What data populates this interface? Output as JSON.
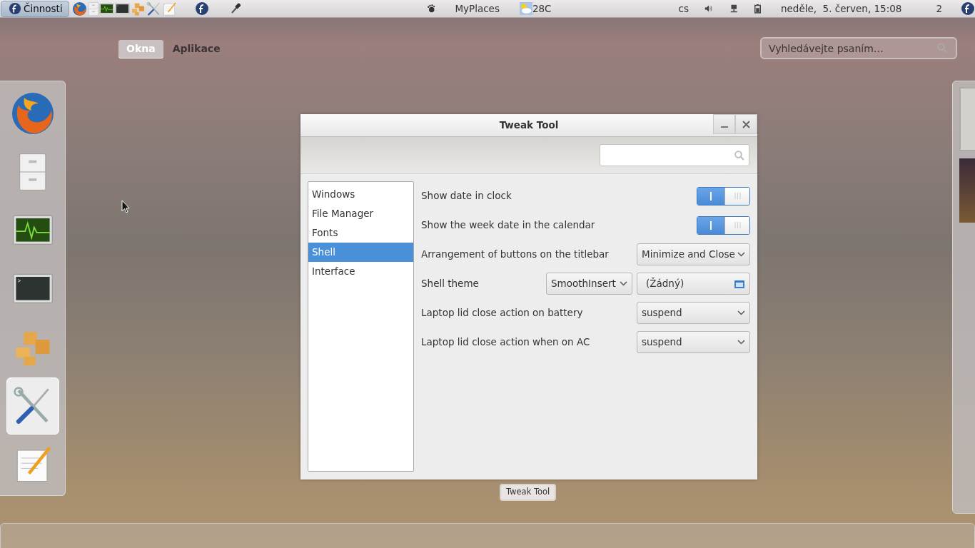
{
  "top_bar": {
    "activities": "Činnosti",
    "launchers": [
      {
        "kind": "browser"
      },
      {
        "kind": "cabinet"
      },
      {
        "kind": "monitor"
      },
      {
        "kind": "terminal"
      },
      {
        "kind": "boxes"
      },
      {
        "kind": "tools"
      },
      {
        "kind": "notepad"
      },
      {
        "kind": "fedora"
      },
      {
        "kind": "dropper"
      }
    ],
    "places": "MyPlaces",
    "weather": "28C",
    "keyboard": "cs",
    "clock": "neděle,  5. červen, 15:08",
    "workspace": "2"
  },
  "overview_tabs": [
    {
      "label": "Okna",
      "selected": true
    },
    {
      "label": "Aplikace",
      "selected": false
    }
  ],
  "search": {
    "placeholder": "Vyhledávejte psaním…"
  },
  "dash": [
    {
      "kind": "browser",
      "selected": false
    },
    {
      "kind": "cabinet",
      "selected": false
    },
    {
      "kind": "monitor",
      "selected": false
    },
    {
      "kind": "terminal",
      "selected": false
    },
    {
      "kind": "boxes",
      "selected": false
    },
    {
      "kind": "tools",
      "selected": true
    },
    {
      "kind": "notepad",
      "selected": false
    }
  ],
  "window": {
    "title": "Tweak Tool",
    "sidebar": [
      {
        "label": "Windows",
        "selected": false
      },
      {
        "label": "File Manager",
        "selected": false
      },
      {
        "label": "Fonts",
        "selected": false
      },
      {
        "label": "Shell",
        "selected": true
      },
      {
        "label": "Interface",
        "selected": false
      }
    ],
    "settings": [
      {
        "kind": "switch",
        "label": "Show date in clock",
        "on": true
      },
      {
        "kind": "switch",
        "label": "Show the week date in the calendar",
        "on": true
      },
      {
        "kind": "combo",
        "label": "Arrangement of buttons on the titlebar",
        "value": "Minimize and Close"
      },
      {
        "kind": "theme",
        "label": "Shell theme",
        "value": "SmoothInsert",
        "file": "(Žádný)"
      },
      {
        "kind": "combo",
        "label": "Laptop lid close action on battery",
        "value": "suspend"
      },
      {
        "kind": "combo",
        "label": "Laptop lid close action when on AC",
        "value": "suspend"
      }
    ]
  },
  "window_caption": "Tweak Tool"
}
